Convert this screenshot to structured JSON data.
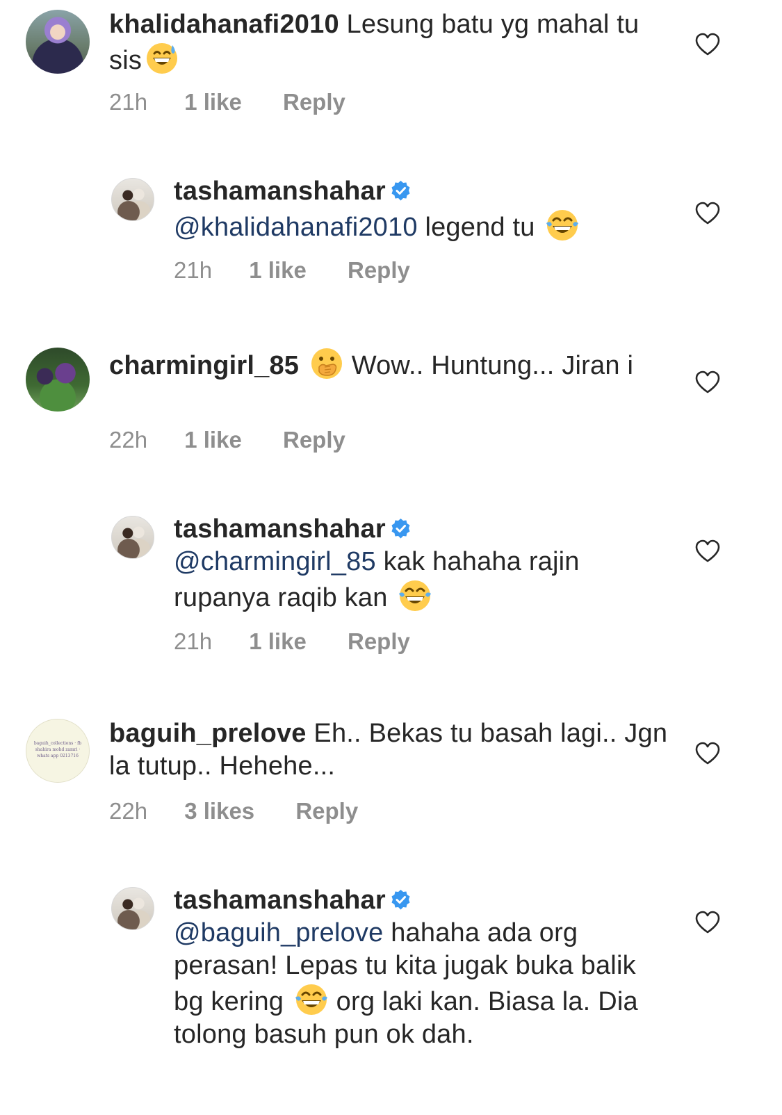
{
  "comments": [
    {
      "username": "khalidahanafi2010",
      "text": "Lesung batu yg mahal tu sis",
      "emoji": "grinning-sweat",
      "time": "21h",
      "likes": "1 like",
      "reply_label": "Reply",
      "reply": {
        "username": "tashamanshahar",
        "verified": true,
        "mention": "@khalidahanafi2010",
        "text": "legend tu",
        "emoji": "tears-of-joy",
        "time": "21h",
        "likes": "1 like",
        "reply_label": "Reply"
      }
    },
    {
      "username": "charmingirl_85",
      "emoji_before": "hand-over-mouth",
      "text": "Wow.. Huntung... Jiran i",
      "time": "22h",
      "likes": "1 like",
      "reply_label": "Reply",
      "reply": {
        "username": "tashamanshahar",
        "verified": true,
        "mention": "@charmingirl_85",
        "text": "kak hahaha rajin rupanya raqib kan",
        "emoji": "tears-of-joy",
        "time": "21h",
        "likes": "1 like",
        "reply_label": "Reply"
      }
    },
    {
      "username": "baguih_prelove",
      "avatar_text": "baguih_collections · fb shahira mohd zamri · whats app 0213716",
      "text": "Eh.. Bekas tu basah lagi.. Jgn la tutup.. Hehehe...",
      "time": "22h",
      "likes": "3 likes",
      "reply_label": "Reply",
      "reply": {
        "username": "tashamanshahar",
        "verified": true,
        "mention": "@baguih_prelove",
        "text_a": "hahaha ada org perasan! Lepas tu kita jugak buka balik bg kering",
        "emoji": "tears-of-joy",
        "text_b": "org laki kan. Biasa la. Dia tolong basuh pun ok dah."
      }
    }
  ],
  "colors": {
    "text": "#262626",
    "meta": "#8e8e8e",
    "mention": "#1f3a64",
    "verified": "#3897f0"
  }
}
